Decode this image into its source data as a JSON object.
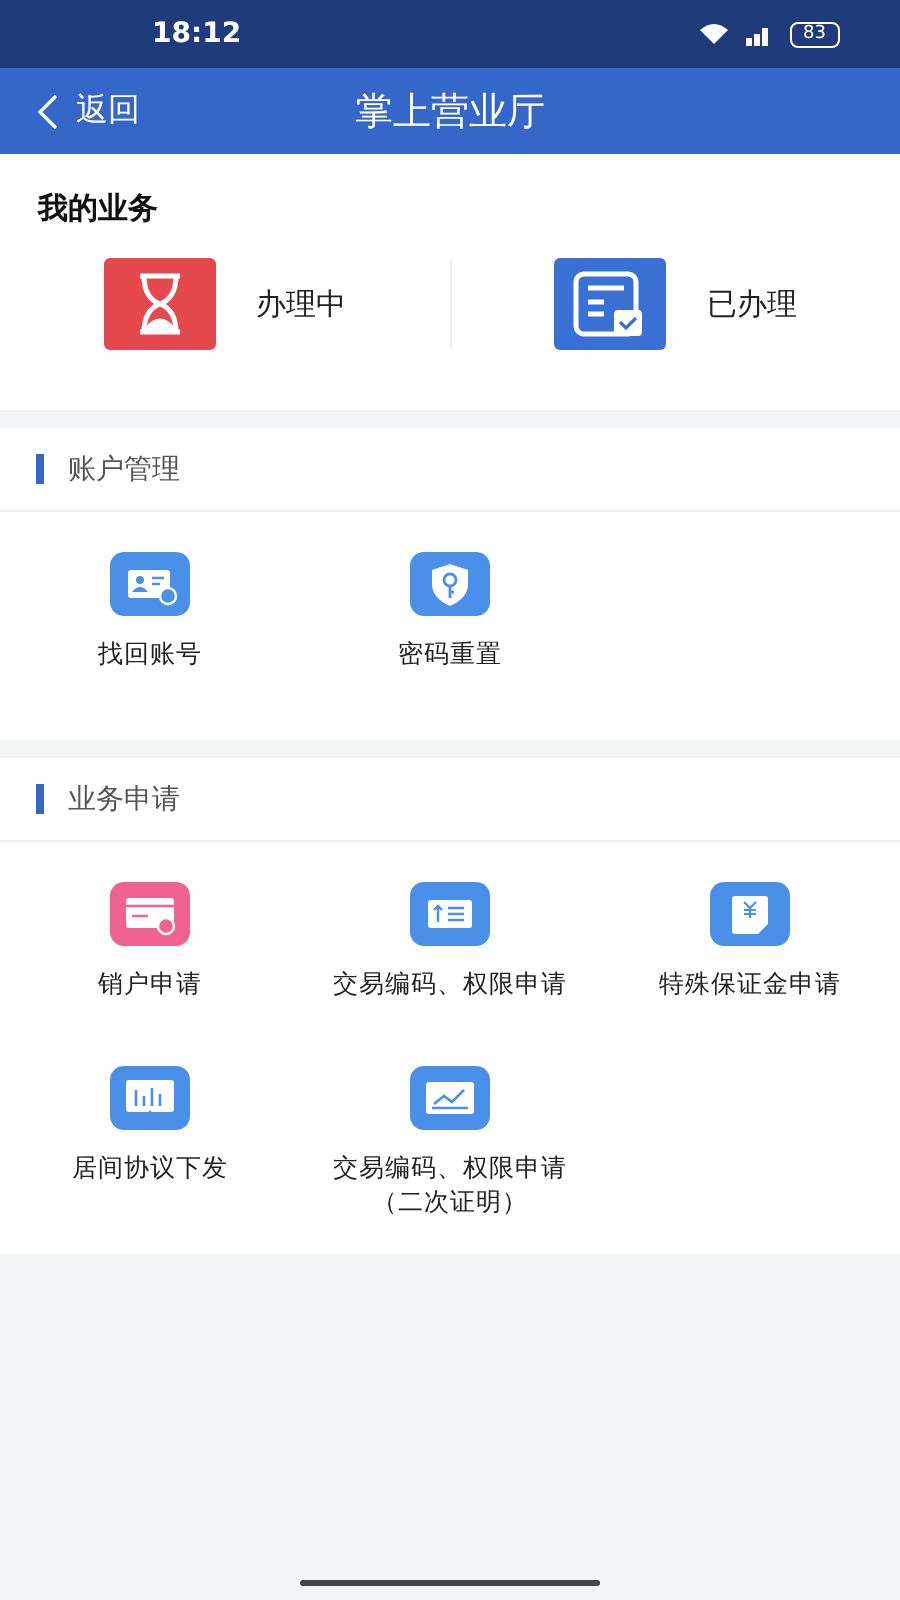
{
  "status_bar": {
    "time": "18:12",
    "battery": "83"
  },
  "header": {
    "back": "返回",
    "title": "掌上营业厅"
  },
  "my_business": {
    "title": "我的业务",
    "items": [
      {
        "label": "办理中",
        "color": "#e5484d"
      },
      {
        "label": "已办理",
        "color": "#3a6fd4"
      }
    ]
  },
  "sections": [
    {
      "title": "账户管理",
      "items": [
        {
          "label": "找回账号",
          "color": "#4a90e8"
        },
        {
          "label": "密码重置",
          "color": "#4a90e8"
        }
      ]
    },
    {
      "title": "业务申请",
      "items": [
        {
          "label": "销户申请",
          "color": "#f06292"
        },
        {
          "label": "交易编码、权限申请",
          "color": "#4a90e8"
        },
        {
          "label": "特殊保证金申请",
          "color": "#4a90e8"
        },
        {
          "label": "居间协议下发",
          "color": "#4a90e8"
        },
        {
          "label": "交易编码、权限申请（二次证明）",
          "color": "#4a90e8"
        }
      ]
    }
  ]
}
